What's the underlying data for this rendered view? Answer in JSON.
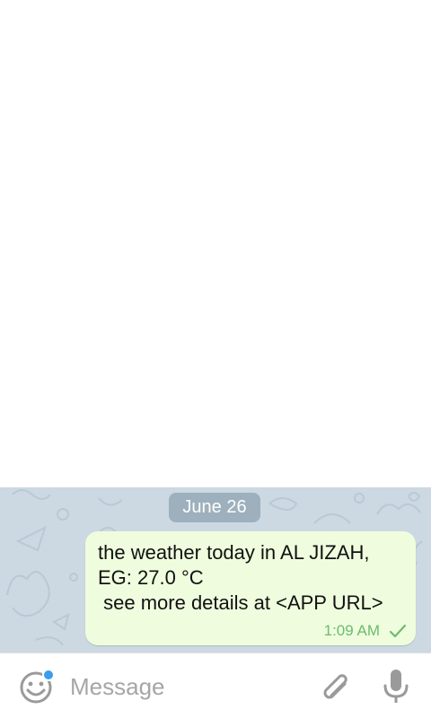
{
  "chat": {
    "date_label": "June 26",
    "message": {
      "text": "the weather today in AL JIZAH, EG: 27.0 °C\n see more details at <APP URL>",
      "time": "1:09 AM",
      "status": "sent-check"
    }
  },
  "composer": {
    "placeholder": "Message",
    "value": "",
    "emoji_icon": "emoji-icon",
    "attach_icon": "paperclip-icon",
    "mic_icon": "microphone-icon"
  },
  "colors": {
    "chat_background": "#ccd9e2",
    "bubble": "#effdde",
    "meta_green": "#6dbb6e",
    "date_pill": "#9eb0bd",
    "accent_blue": "#3a9ded"
  }
}
